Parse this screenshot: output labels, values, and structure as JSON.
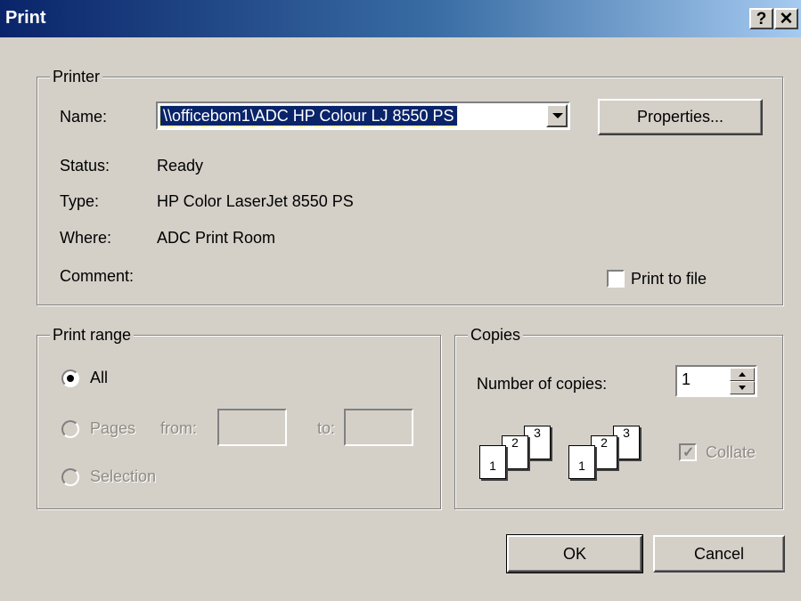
{
  "window": {
    "title": "Print",
    "help_label": "?",
    "close_label": "✕"
  },
  "printer": {
    "group_label": "Printer",
    "name_label": "Name:",
    "name_value": "\\\\officebom1\\ADC HP Colour LJ 8550 PS",
    "properties_label": "Properties...",
    "status_label": "Status:",
    "status_value": "Ready",
    "type_label": "Type:",
    "type_value": "HP Color LaserJet 8550 PS",
    "where_label": "Where:",
    "where_value": "ADC Print Room",
    "comment_label": "Comment:",
    "print_to_file_label": "Print to file",
    "print_to_file_checked": false
  },
  "print_range": {
    "group_label": "Print range",
    "all_label": "All",
    "pages_label": "Pages",
    "from_label": "from:",
    "to_label": "to:",
    "selection_label": "Selection",
    "selected": "all"
  },
  "copies": {
    "group_label": "Copies",
    "number_label": "Number of copies:",
    "number_value": "1",
    "collate_label": "Collate",
    "collate_checked": true,
    "page_numbers": [
      "1",
      "2",
      "3"
    ]
  },
  "buttons": {
    "ok": "OK",
    "cancel": "Cancel"
  }
}
